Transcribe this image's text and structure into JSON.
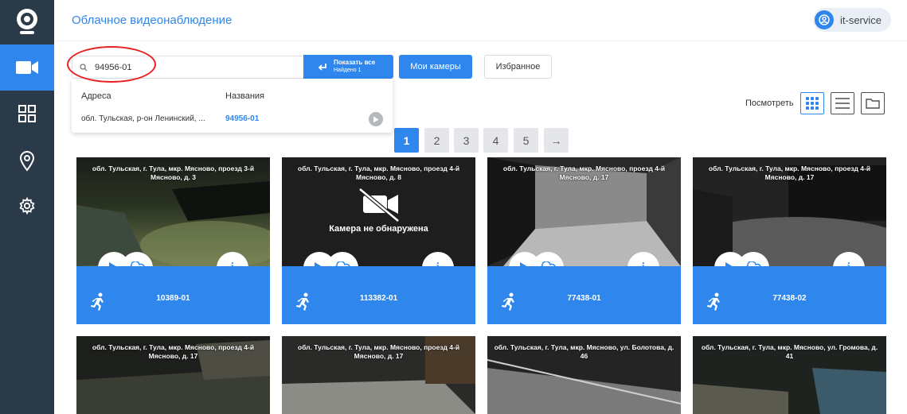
{
  "header": {
    "title": "Облачное видеонаблюдение",
    "user": "it-service"
  },
  "sidebar": {
    "items": [
      {
        "icon": "camera-icon",
        "active": true
      },
      {
        "icon": "grid-icon",
        "active": false
      },
      {
        "icon": "map-pin-icon",
        "active": false
      },
      {
        "icon": "gear-icon",
        "active": false
      }
    ]
  },
  "search": {
    "value": "94956-01",
    "show_all_label": "Показать все",
    "found_label": "Найдено 1",
    "my_cameras_label": "Мои камеры",
    "favorites_label": "Избранное",
    "dropdown": {
      "col_address": "Адреса",
      "col_name": "Названия",
      "result_address": "обл. Тульская, р-он Ленинский, ...",
      "result_name": "94956-01"
    }
  },
  "view": {
    "label": "Посмотреть"
  },
  "pagination": {
    "pages": [
      "1",
      "2",
      "3",
      "4",
      "5"
    ],
    "next": "→",
    "current": "1"
  },
  "cameras": [
    {
      "address": "обл. Тульская, г. Тула, мкр. Мясново, проезд 3-й Мясново, д. 3",
      "id": "10389-01",
      "status": "ok"
    },
    {
      "address": "обл. Тульская, г. Тула, мкр. Мясново, проезд 4-й Мясново, д. 8",
      "id": "113382-01",
      "status": "not_found",
      "status_text": "Камера не обнаружена"
    },
    {
      "address": "обл. Тульская, г. Тула, мкр. Мясново, проезд 4-й Мясново, д. 17",
      "id": "77438-01",
      "status": "ok"
    },
    {
      "address": "обл. Тульская, г. Тула, мкр. Мясново, проезд 4-й Мясново, д. 17",
      "id": "77438-02",
      "status": "ok"
    },
    {
      "address": "обл. Тульская, г. Тула, мкр. Мясново, проезд 4-й Мясново, д. 17"
    },
    {
      "address": "обл. Тульская, г. Тула, мкр. Мясново, проезд 4-й Мясново, д. 17"
    },
    {
      "address": "обл. Тульская, г. Тула, мкр. Мясново, ул. Болотова, д. 46"
    },
    {
      "address": "обл. Тульская, г. Тула, мкр. Мясново, ул. Громова, д. 41"
    }
  ],
  "colors": {
    "accent": "#2f86ec",
    "sidebar": "#2b3a48",
    "highlight": "#e8201f"
  }
}
